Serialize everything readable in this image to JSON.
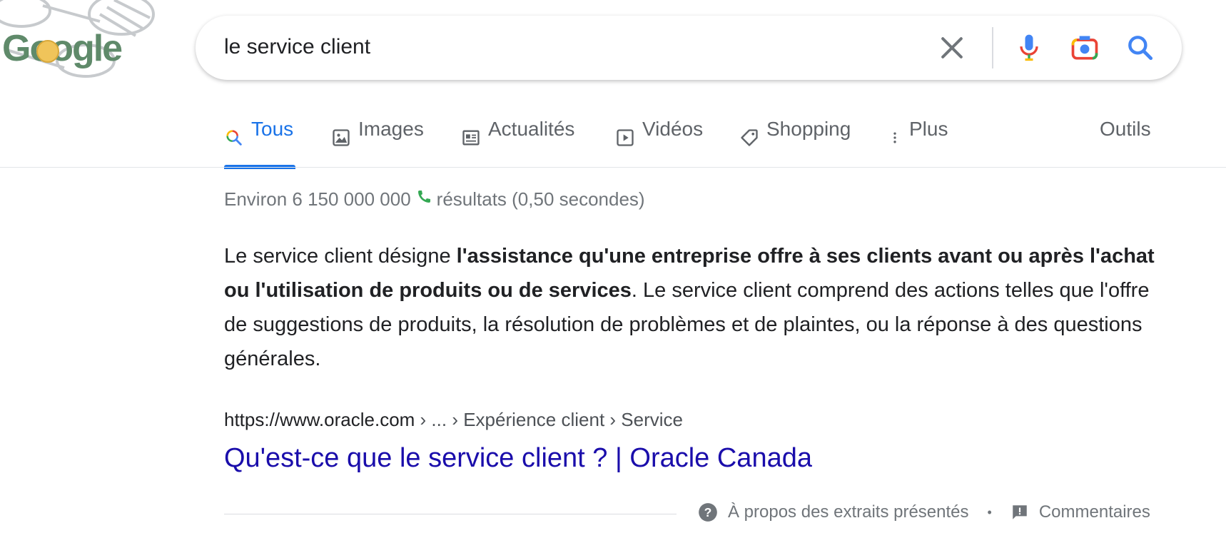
{
  "logo": {
    "text": "Google"
  },
  "search": {
    "query": "le service client",
    "icons": [
      "close-icon",
      "microphone-icon",
      "camera-icon",
      "search-icon"
    ]
  },
  "tabs": [
    {
      "label": "Tous",
      "icon": "search-icon",
      "active": true
    },
    {
      "label": "Images",
      "icon": "image-icon"
    },
    {
      "label": "Actualités",
      "icon": "news-icon"
    },
    {
      "label": "Vidéos",
      "icon": "play-icon"
    },
    {
      "label": "Shopping",
      "icon": "tag-icon"
    },
    {
      "label": "Plus",
      "icon": "more-vert-icon"
    }
  ],
  "tools_label": "Outils",
  "stats": {
    "count": "Environ 6 150 000 000",
    "rest": "résultats (0,50 secondes)"
  },
  "snippet": {
    "intro": "Le service client désigne ",
    "bold": "l'assistance qu'une entreprise offre à ses clients avant ou après l'achat ou l'utilisation de produits ou de services",
    "rest": ". Le service client comprend des actions telles que l'offre de suggestions de produits, la résolution de problèmes et de plaintes, ou la réponse à des questions générales."
  },
  "result": {
    "url": "https://www.oracle.com",
    "breadcrumbs": " › ... › Expérience client › Service",
    "title": "Qu'est-ce que le service client ? | Oracle Canada"
  },
  "footer": {
    "about_label": "À propos des extraits présentés",
    "separator": "•",
    "feedback_label": "Commentaires"
  },
  "colors": {
    "accent": "#1a73e8",
    "link": "#1a0dab",
    "muted": "#70757a"
  }
}
